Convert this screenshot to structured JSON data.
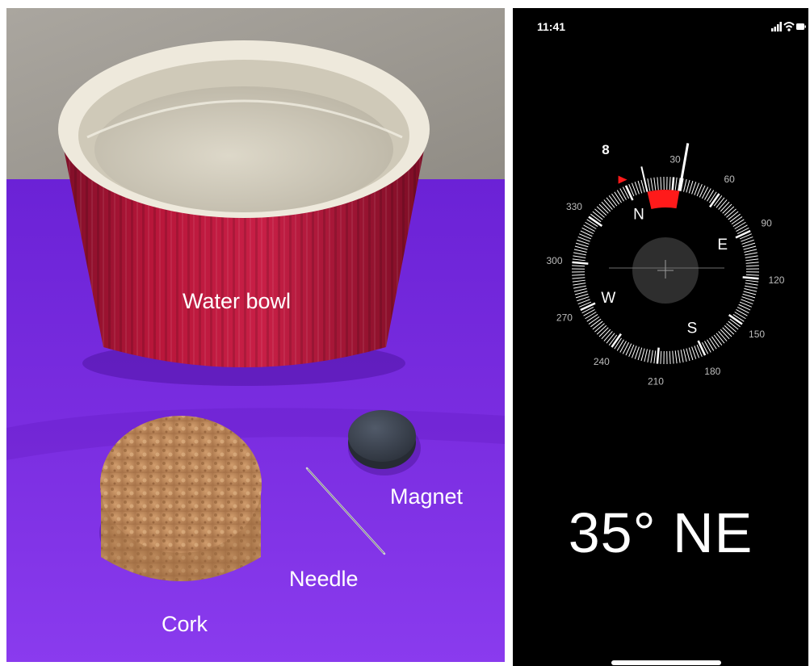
{
  "photo": {
    "labels": {
      "water_bowl": "Water bowl",
      "cork": "Cork",
      "needle": "Needle",
      "magnet": "Magnet"
    },
    "colors": {
      "wall": "#9e9a93",
      "mat": "#7a2de0",
      "bowl": "#b8163a",
      "cork": "#c08a5a",
      "magnet": "#3d4451"
    }
  },
  "phone": {
    "status_bar": {
      "time": "11:41",
      "icons": [
        "signal-icon",
        "wifi-icon",
        "battery-icon"
      ]
    },
    "compass": {
      "current_bearing_marker": "8",
      "heading_degrees": 35,
      "ring_numbers": [
        "30",
        "60",
        "90",
        "120",
        "150",
        "180",
        "210",
        "240",
        "270",
        "300",
        "330"
      ],
      "cardinals": [
        "N",
        "E",
        "S",
        "W"
      ],
      "accent_color": "#ff1a1a"
    },
    "heading_text": "35° NE"
  }
}
